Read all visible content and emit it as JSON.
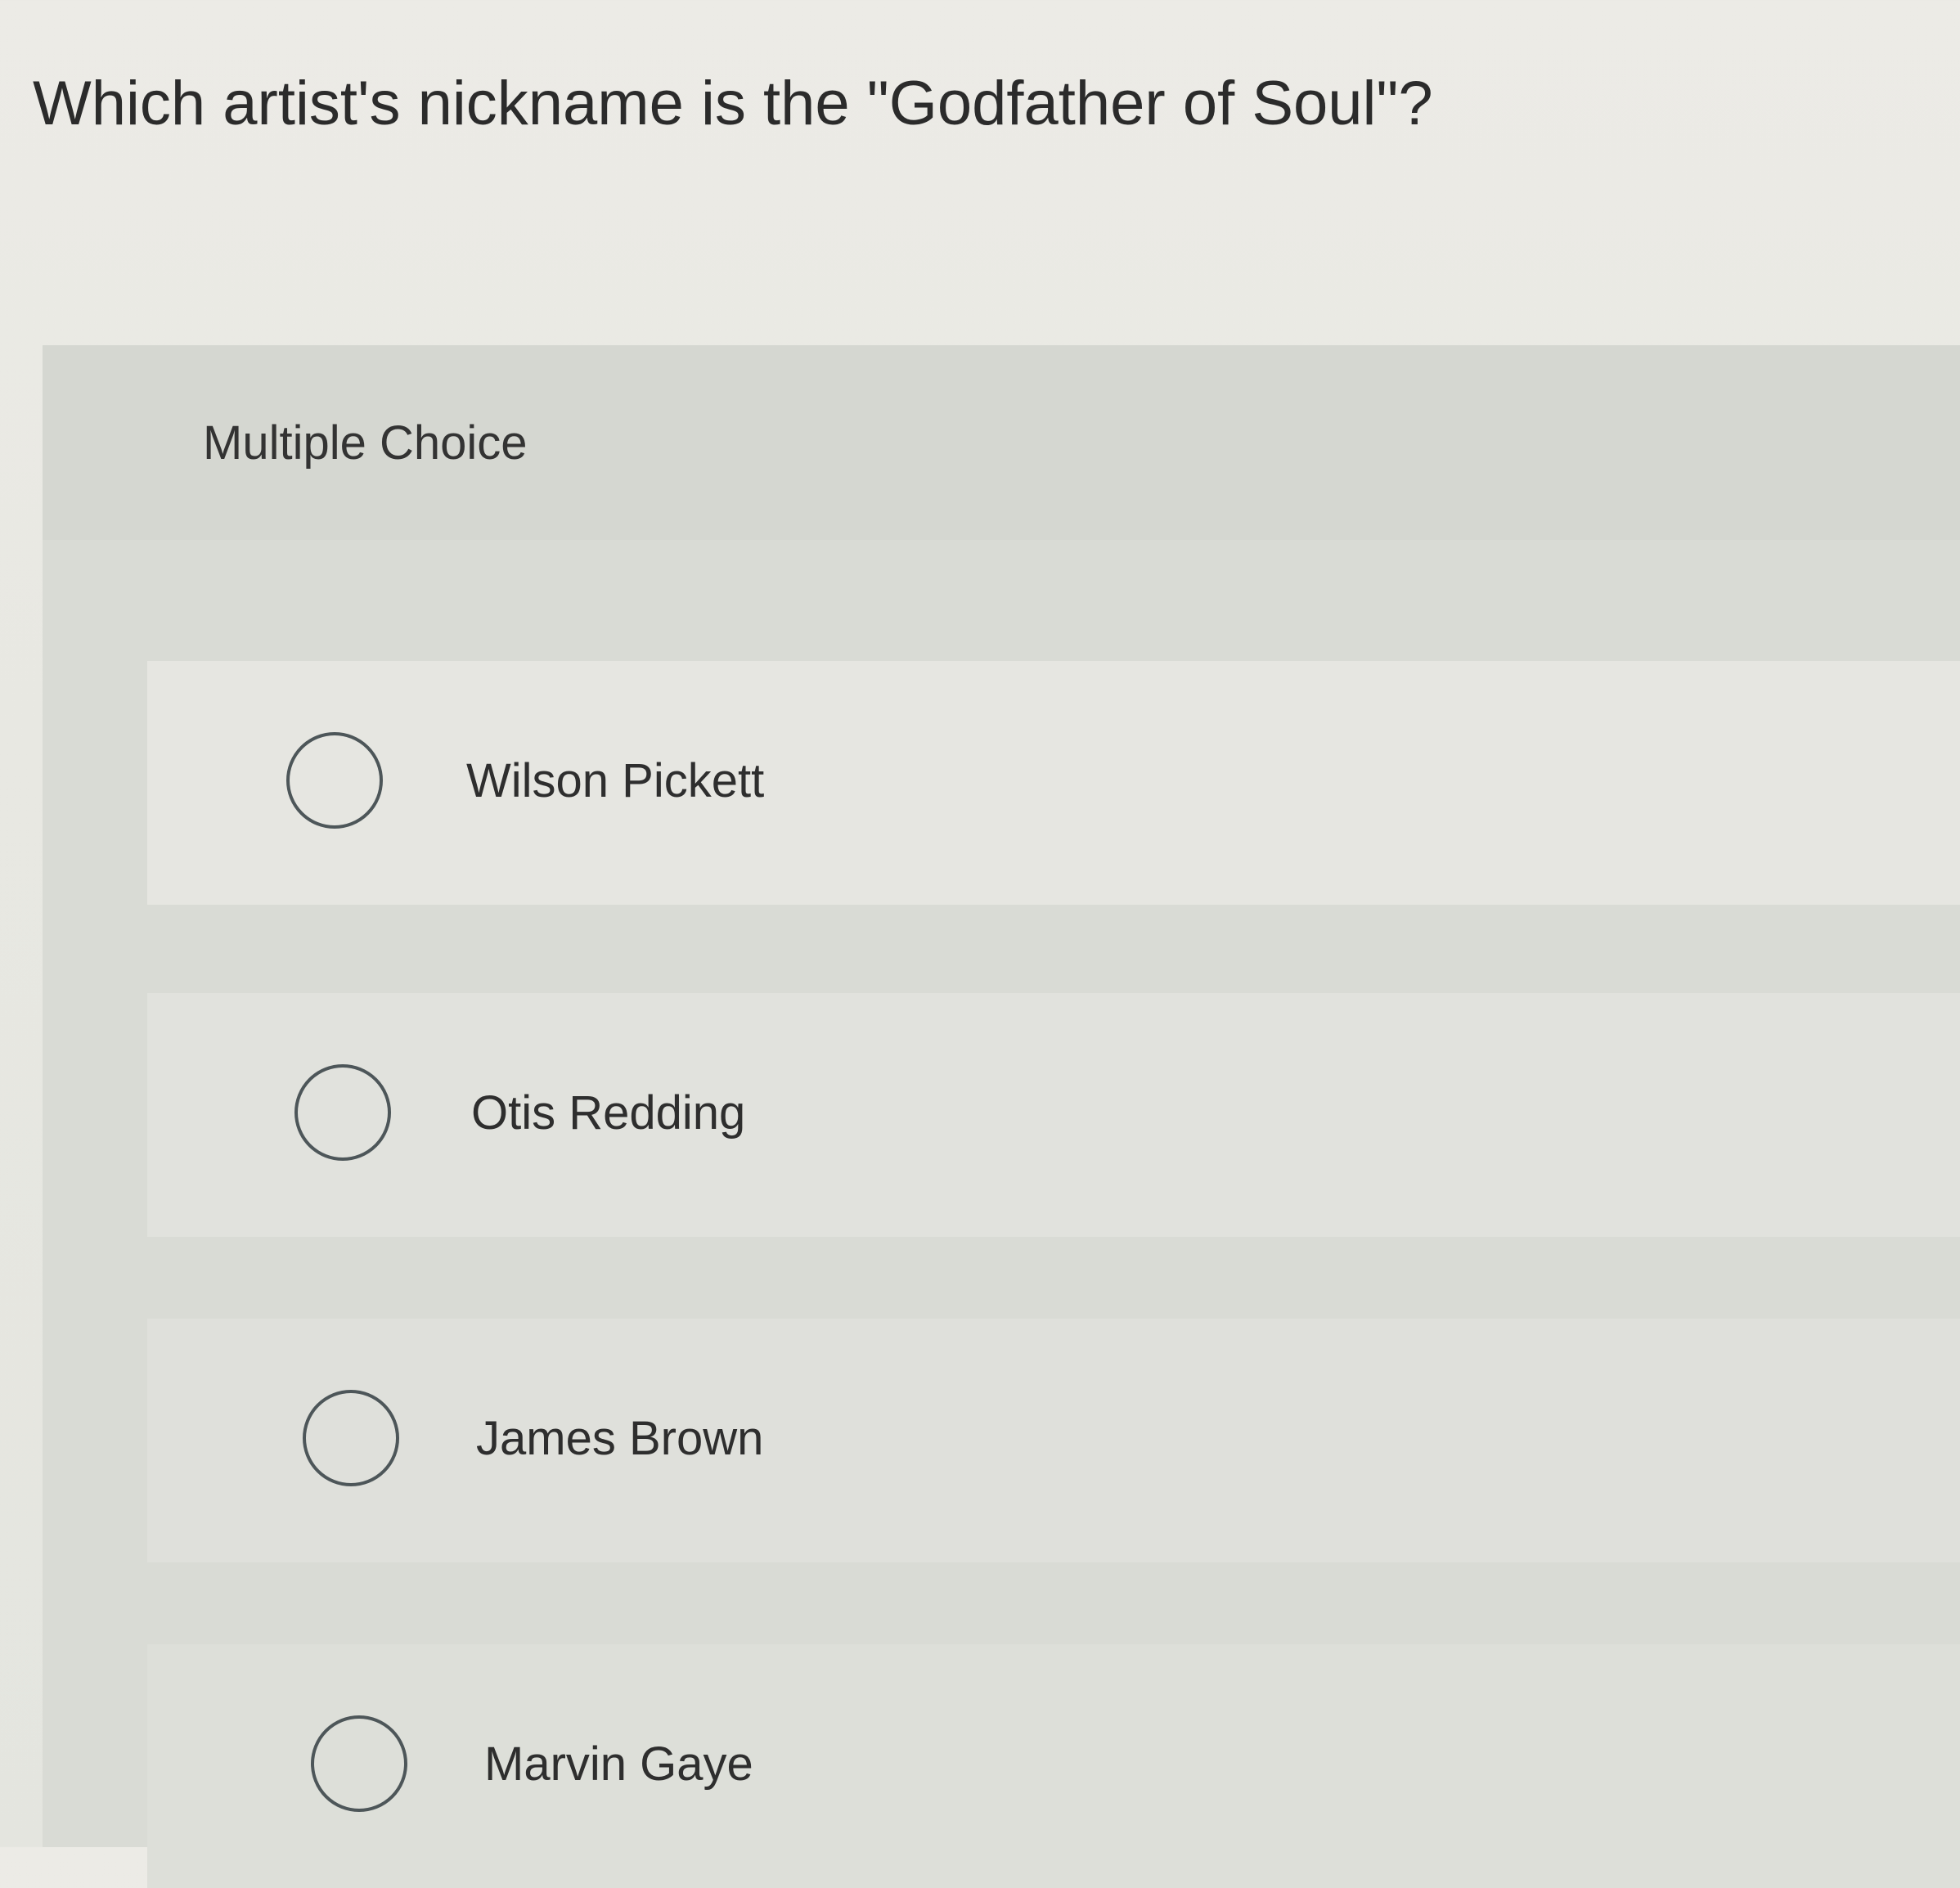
{
  "question": {
    "text": "Which artist's nickname is the \"Godfather of Soul\"?"
  },
  "panel": {
    "label": "Multiple Choice",
    "options": [
      {
        "label": "Wilson Pickett",
        "selected": false
      },
      {
        "label": "Otis Redding",
        "selected": false
      },
      {
        "label": "James Brown",
        "selected": false
      },
      {
        "label": "Marvin Gaye",
        "selected": false
      }
    ]
  },
  "icons": {
    "radio": "radio-unchecked-icon"
  }
}
